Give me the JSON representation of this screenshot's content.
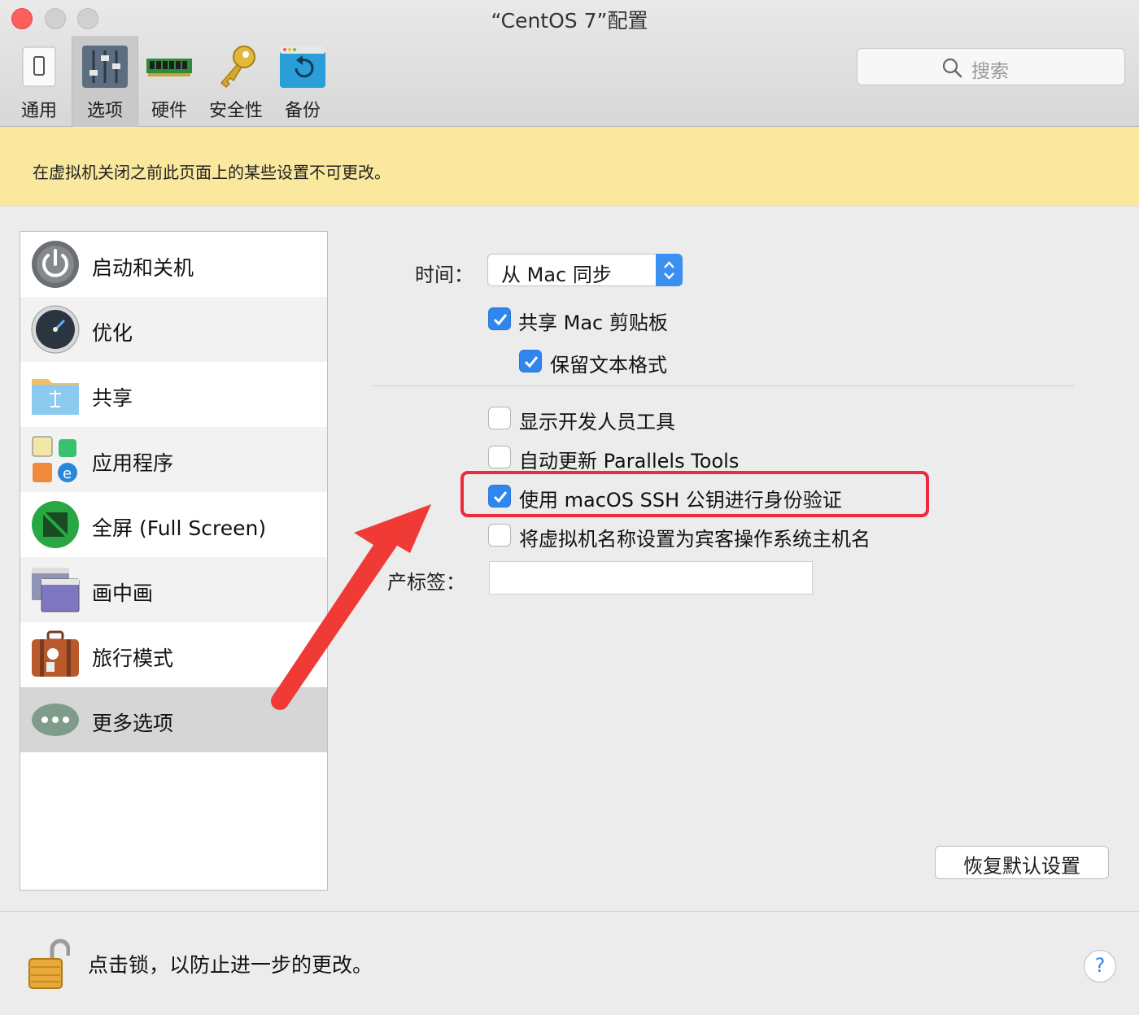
{
  "window": {
    "title": "“CentOS 7”配置"
  },
  "toolbar": {
    "items": [
      {
        "label": "通用",
        "icon": "phone-icon"
      },
      {
        "label": "选项",
        "icon": "sliders-icon"
      },
      {
        "label": "硬件",
        "icon": "memory-chip-icon"
      },
      {
        "label": "安全性",
        "icon": "key-icon"
      },
      {
        "label": "备份",
        "icon": "backup-icon"
      }
    ],
    "selected": "选项"
  },
  "search": {
    "placeholder": "搜索"
  },
  "banner": {
    "text": "在虚拟机关闭之前此页面上的某些设置不可更改。"
  },
  "sidebar": {
    "items": [
      {
        "label": "启动和关机",
        "icon": "power-icon"
      },
      {
        "label": "优化",
        "icon": "speedometer-icon"
      },
      {
        "label": "共享",
        "icon": "shared-folder-icon"
      },
      {
        "label": "应用程序",
        "icon": "applications-icon"
      },
      {
        "label": "全屏 (Full Screen)",
        "icon": "fullscreen-icon"
      },
      {
        "label": "画中画",
        "icon": "picture-in-picture-icon"
      },
      {
        "label": "旅行模式",
        "icon": "suitcase-icon"
      },
      {
        "label": "更多选项",
        "icon": "more-options-icon"
      }
    ],
    "selected": "更多选项"
  },
  "form": {
    "time_label": "时间：",
    "time_value": "从 Mac 同步",
    "share_clipboard": {
      "label": "共享 Mac 剪贴板",
      "checked": true
    },
    "keep_format": {
      "label": "保留文本格式",
      "checked": true
    },
    "dev_tools": {
      "label": "显示开发人员工具",
      "checked": false
    },
    "auto_update": {
      "label": "自动更新 Parallels Tools",
      "checked": false
    },
    "ssh_auth": {
      "label": "使用 macOS SSH 公钥进行身份验证",
      "checked": true
    },
    "hostname": {
      "label": "将虚拟机名称设置为宾客操作系统主机名",
      "checked": false
    },
    "asset_label": "产标签：",
    "asset_value": "",
    "restore_button": "恢复默认设置"
  },
  "footer": {
    "lock_text": "点击锁，以防止进一步的更改。",
    "help": "?"
  },
  "colors": {
    "accent": "#2f86ee",
    "banner": "#f9e89e",
    "highlight": "#ed2b3e"
  }
}
